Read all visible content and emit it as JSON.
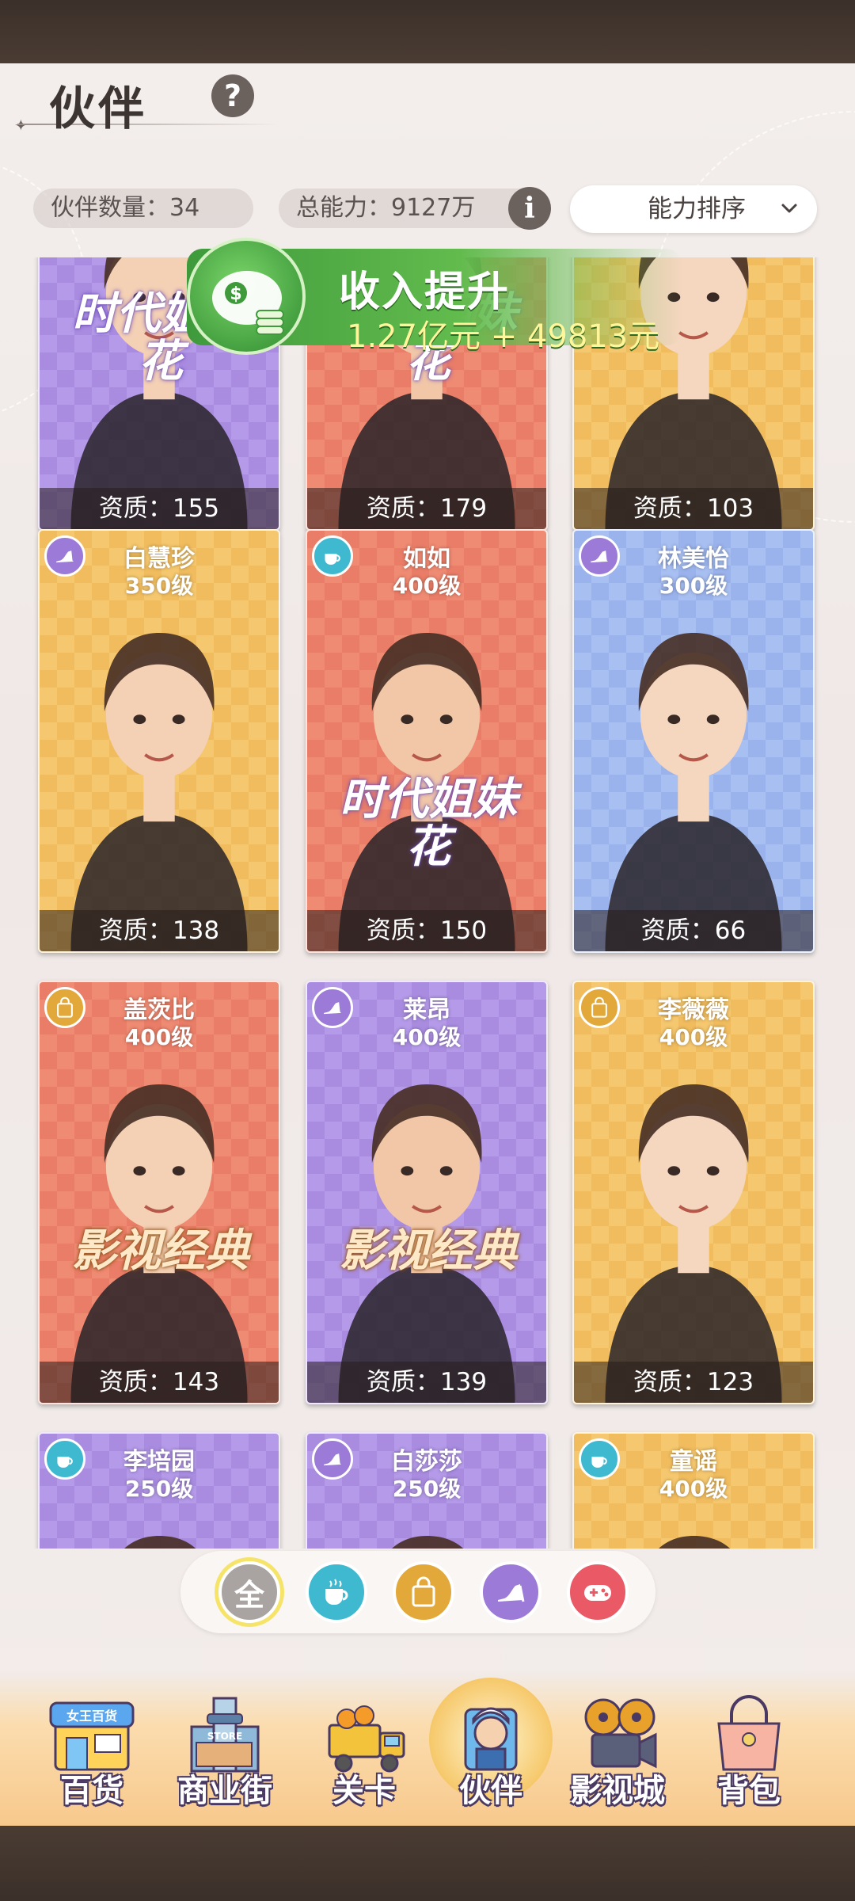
{
  "header": {
    "title": "伙伴",
    "help": "?"
  },
  "stats": {
    "partner_count": "伙伴数量：34",
    "total_power": "总能力：9127万",
    "info": "i"
  },
  "sort": {
    "selected": "能力排序"
  },
  "income_banner": {
    "title": "收入提升",
    "value": "1.27亿元 + 49813元"
  },
  "cards": [
    {
      "name": "",
      "level": "",
      "quality": "资质：155",
      "category": "shoe",
      "bg": "purple",
      "tag": "时代姐妹花"
    },
    {
      "name": "",
      "level": "",
      "quality": "资质：179",
      "category": "cup",
      "bg": "red",
      "tag": "时代姐妹花"
    },
    {
      "name": "",
      "level": "",
      "quality": "资质：103",
      "category": "bag",
      "bg": "yellow",
      "tag": ""
    },
    {
      "name": "白慧珍",
      "level": "350级",
      "quality": "资质：138",
      "category": "shoe",
      "bg": "yellow",
      "tag": ""
    },
    {
      "name": "如如",
      "level": "400级",
      "quality": "资质：150",
      "category": "cup",
      "bg": "red",
      "tag": "时代姐妹花"
    },
    {
      "name": "林美怡",
      "level": "300级",
      "quality": "资质：66",
      "category": "shoe",
      "bg": "blue",
      "tag": ""
    },
    {
      "name": "盖茨比",
      "level": "400级",
      "quality": "资质：143",
      "category": "bag",
      "bg": "red",
      "tag": "影视经典"
    },
    {
      "name": "莱昂",
      "level": "400级",
      "quality": "资质：139",
      "category": "shoe",
      "bg": "purple",
      "tag": "影视经典"
    },
    {
      "name": "李薇薇",
      "level": "400级",
      "quality": "资质：123",
      "category": "bag",
      "bg": "yellow",
      "tag": ""
    },
    {
      "name": "李培园",
      "level": "250级",
      "quality": "",
      "category": "cup",
      "bg": "purple",
      "tag": ""
    },
    {
      "name": "白莎莎",
      "level": "250级",
      "quality": "",
      "category": "shoe",
      "bg": "purple",
      "tag": ""
    },
    {
      "name": "童谣",
      "level": "400级",
      "quality": "",
      "category": "cup",
      "bg": "yellow",
      "tag": ""
    }
  ],
  "filter": {
    "all_label": "全",
    "options": [
      "all",
      "cup-icon",
      "bag-icon",
      "shoe-icon",
      "gamepad-icon"
    ]
  },
  "nav": [
    {
      "label": "百货",
      "icon": "department-store-icon"
    },
    {
      "label": "商业街",
      "icon": "commercial-street-icon"
    },
    {
      "label": "关卡",
      "icon": "delivery-truck-icon"
    },
    {
      "label": "伙伴",
      "icon": "partner-icon",
      "active": true
    },
    {
      "label": "影视城",
      "icon": "film-reel-icon"
    },
    {
      "label": "背包",
      "icon": "handbag-icon"
    }
  ],
  "colors": {
    "accent_green": "#4fae42",
    "income_value": "#fff59a",
    "filter_cup": "#3eb9cf",
    "filter_bag": "#e2a93a",
    "filter_shoe": "#9c7ad8",
    "filter_game": "#ea5a66"
  }
}
